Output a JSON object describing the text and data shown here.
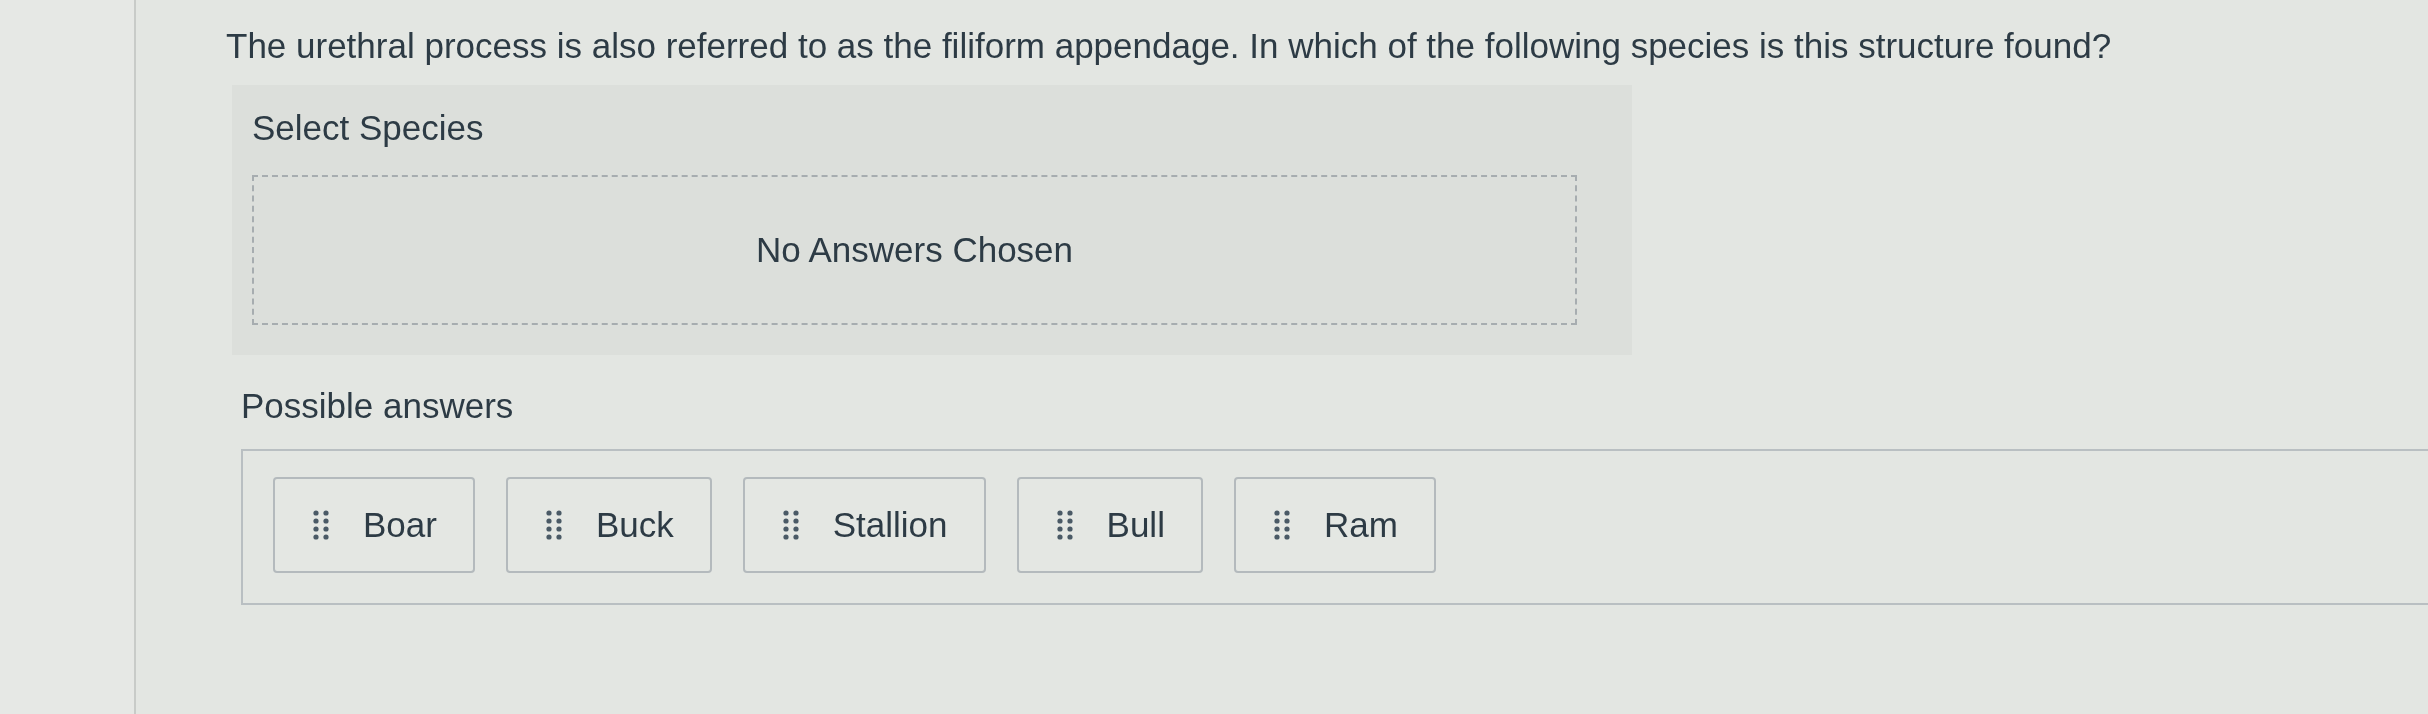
{
  "question": "The urethral process is also referred to as the filiform appendage. In which of the following species is this structure found?",
  "drop_zone": {
    "label": "Select Species",
    "empty_text": "No Answers Chosen"
  },
  "answer_bank": {
    "label": "Possible answers",
    "items": [
      {
        "label": "Boar"
      },
      {
        "label": "Buck"
      },
      {
        "label": "Stallion"
      },
      {
        "label": "Bull"
      },
      {
        "label": "Ram"
      }
    ]
  }
}
